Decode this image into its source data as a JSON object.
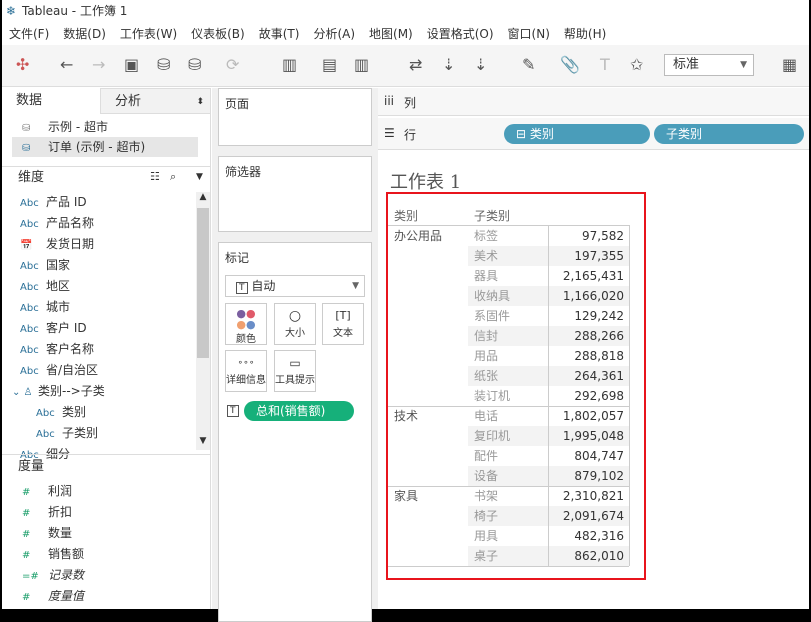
{
  "window": {
    "title": "Tableau - 工作簿 1"
  },
  "menu": [
    "文件(F)",
    "数据(D)",
    "工作表(W)",
    "仪表板(B)",
    "故事(T)",
    "分析(A)",
    "地图(M)",
    "设置格式(O)",
    "窗口(N)",
    "帮助(H)"
  ],
  "toolbar": {
    "fit_select": "标准"
  },
  "left_panel": {
    "tabs": [
      "数据",
      "分析"
    ],
    "datasources": [
      "示例 - 超市",
      "订单 (示例 - 超市)"
    ],
    "dimensions_label": "维度",
    "dimensions": [
      {
        "icon": "Abc",
        "label": "产品 ID"
      },
      {
        "icon": "Abc",
        "label": "产品名称"
      },
      {
        "icon": "calendar",
        "label": "发货日期"
      },
      {
        "icon": "Abc",
        "label": "国家"
      },
      {
        "icon": "Abc",
        "label": "地区"
      },
      {
        "icon": "Abc",
        "label": "城市"
      },
      {
        "icon": "Abc",
        "label": "客户 ID"
      },
      {
        "icon": "Abc",
        "label": "客户名称"
      },
      {
        "icon": "Abc",
        "label": "省/自治区"
      },
      {
        "icon": "hierarchy",
        "label": "类别-->子类"
      },
      {
        "icon": "Abc",
        "label": "类别"
      },
      {
        "icon": "Abc",
        "label": "子类别"
      },
      {
        "icon": "Abc",
        "label": "细分"
      }
    ],
    "measures_label": "度量",
    "measures": [
      {
        "icon": "#",
        "label": "利润"
      },
      {
        "icon": "#",
        "label": "折扣"
      },
      {
        "icon": "#",
        "label": "数量"
      },
      {
        "icon": "#",
        "label": "销售额"
      },
      {
        "icon": "=#",
        "label": "记录数"
      },
      {
        "icon": "#",
        "label": "度量值"
      }
    ]
  },
  "shelves": {
    "pages": "页面",
    "filters": "筛选器",
    "marks": "标记",
    "mark_type": "自动",
    "mark_buttons": [
      "颜色",
      "大小",
      "文本",
      "详细信息",
      "工具提示"
    ],
    "mark_pill": "总和(销售额)",
    "columns": "列",
    "rows": "行",
    "row_pills": [
      "类别",
      "子类别"
    ]
  },
  "view": {
    "sheet_title": "工作表 1",
    "headers": [
      "类别",
      "子类别"
    ],
    "groups": [
      {
        "category": "办公用品",
        "rows": [
          [
            "标签",
            "97,582"
          ],
          [
            "美术",
            "197,355"
          ],
          [
            "器具",
            "2,165,431"
          ],
          [
            "收纳具",
            "1,166,020"
          ],
          [
            "系固件",
            "129,242"
          ],
          [
            "信封",
            "288,266"
          ],
          [
            "用品",
            "288,818"
          ],
          [
            "纸张",
            "264,361"
          ],
          [
            "装订机",
            "292,698"
          ]
        ]
      },
      {
        "category": "技术",
        "rows": [
          [
            "电话",
            "1,802,057"
          ],
          [
            "复印机",
            "1,995,048"
          ],
          [
            "配件",
            "804,747"
          ],
          [
            "设备",
            "879,102"
          ]
        ]
      },
      {
        "category": "家具",
        "rows": [
          [
            "书架",
            "2,310,821"
          ],
          [
            "椅子",
            "2,091,674"
          ],
          [
            "用具",
            "482,316"
          ],
          [
            "桌子",
            "862,010"
          ]
        ]
      }
    ]
  },
  "colors": {
    "pill_dim": "#4a9dba",
    "pill_measure": "#16b07a",
    "highlight": "#e8141c"
  }
}
